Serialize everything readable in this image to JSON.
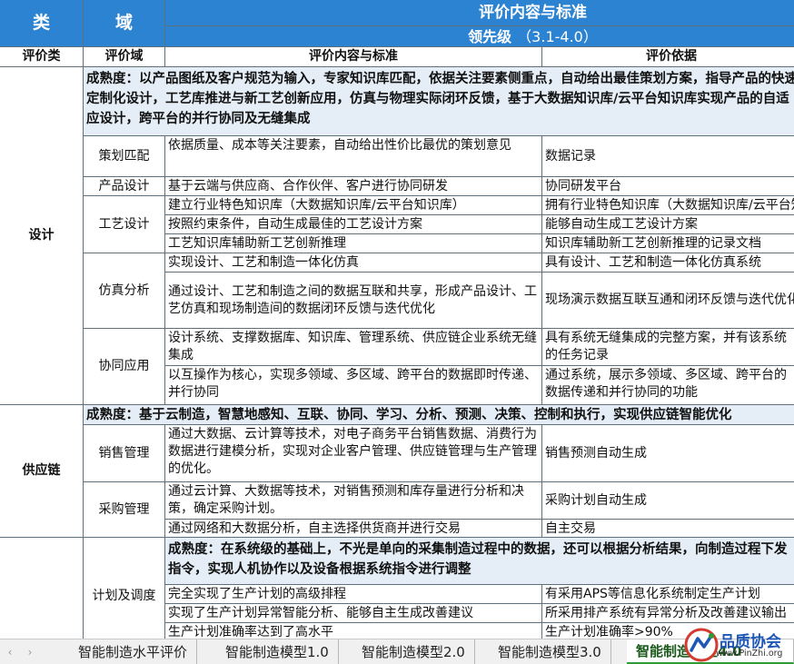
{
  "header": {
    "category_title": "类",
    "domain_title": "域",
    "criteria_title": "评价内容与标准",
    "level_name": "领先级",
    "level_range": "（3.1-4.0）",
    "col_category": "评价类",
    "col_domain": "评价域",
    "col_content": "评价内容与标准",
    "col_basis": "评价依据"
  },
  "sections": {
    "design": {
      "category": "设计",
      "maturity": "成熟度：以产品图纸及客户规范为输入，专家知识库匹配，依据关注要素侧重点，自动给出最佳策划方案，指导产品的快速定制化设计，工艺库推进与新工艺创新应用，仿真与物理实际闭环反馈，基于大数据知识库/云平台知识库实现产品的自适应设计，跨平台的并行协同及无缝集成",
      "rows": [
        {
          "content": "依据质量、成本等关注要素，自动给出性价比最优的策划意见",
          "basis": "数据记录"
        },
        {
          "content": "基于云端与供应商、合作伙伴、客户进行协同研发",
          "basis": "协同研发平台"
        },
        {
          "content": "建立行业特色知识库（大数据知识库/云平台知识库）",
          "basis": "拥有行业特色知识库（大数据知识库/云平台知识库）"
        },
        {
          "content": "按照约束条件，自动生成最佳的工艺设计方案",
          "basis": "能够自动生成工艺设计方案"
        },
        {
          "content": "工艺知识库辅助新工艺创新推理",
          "basis": "知识库辅助新工艺创新推理的记录文档"
        },
        {
          "content": "实现设计、工艺和制造一体化仿真",
          "basis": "具有设计、工艺和制造一体化仿真系统"
        },
        {
          "content": "通过设计、工艺和制造之间的数据互联和共享，形成产品设计、工艺仿真和现场制造间的数据闭环反馈与迭代优化",
          "basis": "现场演示数据互联互通和闭环反馈与迭代优化"
        },
        {
          "content": "设计系统、支撑数据库、知识库、管理系统、供应链企业系统无缝集成",
          "basis": "具有系统无缝集成的完整方案，并有该系统的任务记录"
        },
        {
          "content": "以互操作为核心，实现多领域、多区域、跨平台的数据即时传递、并行协同",
          "basis": "通过系统，展示多领域、多区域、跨平台的数据传递和并行协同的功能"
        }
      ],
      "domains": {
        "planning": "策划匹配",
        "product": "产品设计",
        "process": "工艺设计",
        "simulation": "仿真分析",
        "collab": "协同应用"
      }
    },
    "supply": {
      "category": "供应链",
      "maturity": "成熟度：基于云制造，智慧地感知、互联、协同、学习、分析、预测、决策、控制和执行，实现供应链智能优化",
      "rows": [
        {
          "content": "通过大数据、云计算等技术，对电子商务平台销售数据、消费行为数据进行建模分析，实现对企业客户管理、供应链管理与生产管理的优化。",
          "basis": "销售预测自动生成"
        },
        {
          "content": "通过云计算、大数据等技术，对销售预测和库存量进行分析和决策，确定采购计划。",
          "basis": "采购计划自动生成"
        },
        {
          "content": "通过网络和大数据分析，自主选择供货商并进行交易",
          "basis": "自主交易"
        }
      ],
      "domains": {
        "sales": "销售管理",
        "purchase": "采购管理"
      }
    },
    "production": {
      "maturity": "成熟度：在系统级的基础上，不光是单向的采集制造过程中的数据，还可以根据分析结果，向制造过程下发指令，实现人机协作以及设备根据系统指令进行调整",
      "rows": [
        {
          "content": "完全实现了生产计划的高级排程",
          "basis": "有采用APS等信息化系统制定生产计划"
        },
        {
          "content": "实现了生产计划异常智能分析、能够自主生成改善建议",
          "basis": "所采用排产系统有异常分析及改善建议输出"
        },
        {
          "content": "生产计划准确率达到了高水平",
          "basis": "生产计划准确率>90%"
        }
      ],
      "domains": {
        "planning": "计划及调度"
      }
    }
  },
  "tabs": [
    {
      "label": "智能制造水平评价"
    },
    {
      "label": "智能制造模型1.0"
    },
    {
      "label": "智能制造模型2.0"
    },
    {
      "label": "智能制造模型3.0"
    },
    {
      "label": "智能制造模型4.0"
    }
  ],
  "watermark": {
    "title": "品质协会",
    "url": "www.PinZhi.org"
  },
  "colors": {
    "header_blue": "#2c83d1",
    "maturity_bg": "#e5eef7",
    "grid_line": "#5f6f7c",
    "active_tab": "#2f9a3a"
  }
}
